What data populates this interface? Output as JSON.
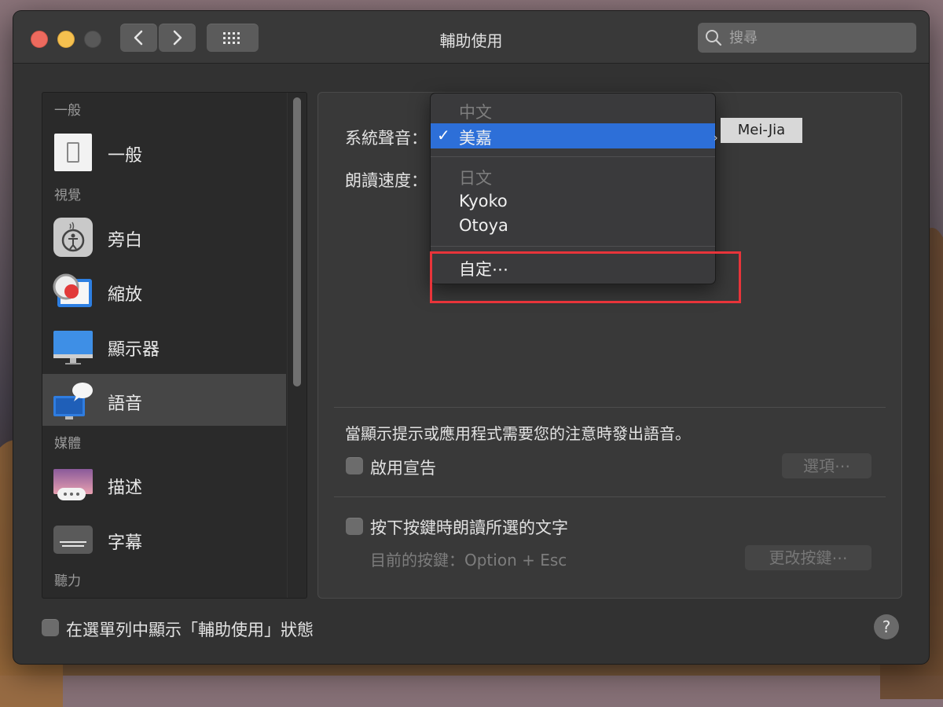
{
  "window": {
    "title": "輔助使用"
  },
  "search": {
    "placeholder": "搜尋"
  },
  "sidebar": {
    "headers": [
      "一般",
      "視覺",
      "媒體",
      "聽力"
    ],
    "items": [
      {
        "label": "一般",
        "icon": "general-icon"
      },
      {
        "label": "旁白",
        "icon": "voiceover-icon"
      },
      {
        "label": "縮放",
        "icon": "zoom-icon"
      },
      {
        "label": "顯示器",
        "icon": "display-icon"
      },
      {
        "label": "語音",
        "icon": "speech-icon",
        "selected": true
      },
      {
        "label": "描述",
        "icon": "descriptions-icon"
      },
      {
        "label": "字幕",
        "icon": "captions-icon"
      }
    ]
  },
  "speech": {
    "system_voice_label": "系統聲音：",
    "speaking_rate_label": "朗讀速度：",
    "voice_tooltip": "Mei-Jia"
  },
  "voice_menu": {
    "group_chinese": "中文",
    "selected": "美嘉",
    "group_japanese": "日文",
    "items": [
      "Kyoko",
      "Otoya"
    ],
    "custom": "自定⋯"
  },
  "announcements": {
    "description": "當顯示提示或應用程式需要您的注意時發出語音。",
    "enable_label": "啟用宣告",
    "enable_checked": false,
    "options_button": "選項⋯"
  },
  "key_speak": {
    "label": "按下按鍵時朗讀所選的文字",
    "checked": false,
    "current_key": "目前的按鍵：Option + Esc",
    "change_button": "更改按鍵⋯"
  },
  "footer": {
    "menubar_status_label": "在選單列中顯示「輔助使用」狀態",
    "menubar_status_checked": false,
    "help": "?"
  },
  "colors": {
    "accent": "#2d6fd8",
    "highlight": "#e8343a"
  }
}
